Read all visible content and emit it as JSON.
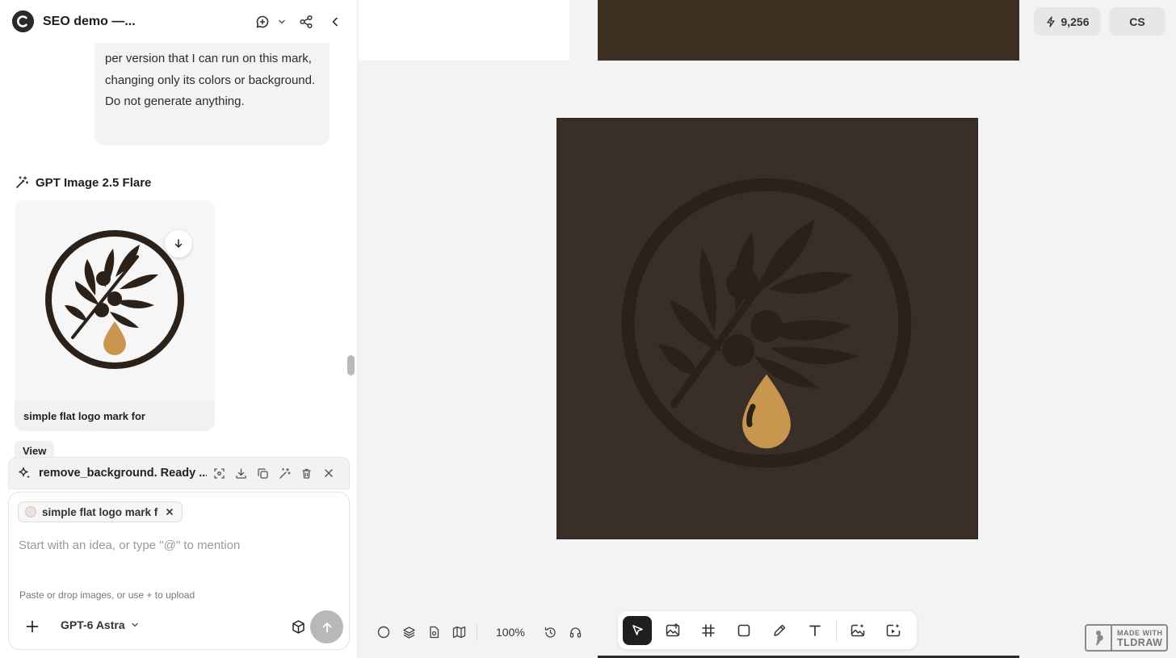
{
  "header": {
    "project_title": "SEO demo —..."
  },
  "chat": {
    "user_message": "per version that I can run on this mark, changing only its colors or background. Do not generate anything.",
    "model_name": "GPT Image 2.5 Flare",
    "result_caption": "simple flat logo mark for",
    "view_label": "View"
  },
  "task": {
    "label": "remove_background. Ready ..."
  },
  "composer": {
    "attachment_label": "simple flat logo mark for...",
    "placeholder": "Start with an idea, or type \"@\" to mention",
    "upload_hint": "Paste or drop images, or use + to upload",
    "model_select": "GPT-6 Astra"
  },
  "canvas": {
    "credits": "9,256",
    "avatar_initials": "CS",
    "zoom": "100%"
  },
  "watermark": {
    "line1": "MADE WITH",
    "line2": "TLDRAW"
  },
  "colors": {
    "logo_dark": "#2b2118",
    "logo_gold": "#c8964e",
    "canvas_bg": "#3a2f28",
    "active_tool": "#1f1f1f"
  },
  "icons": {
    "toolbar": [
      "select-arrow-icon",
      "image-upload-icon",
      "frame-hash-icon",
      "rectangle-icon",
      "pencil-icon",
      "text-icon",
      "ai-image-icon",
      "ai-video-icon"
    ],
    "view_tools": [
      "circle-icon",
      "layers-icon",
      "page-icon",
      "map-icon",
      "history-icon",
      "headset-icon"
    ]
  }
}
